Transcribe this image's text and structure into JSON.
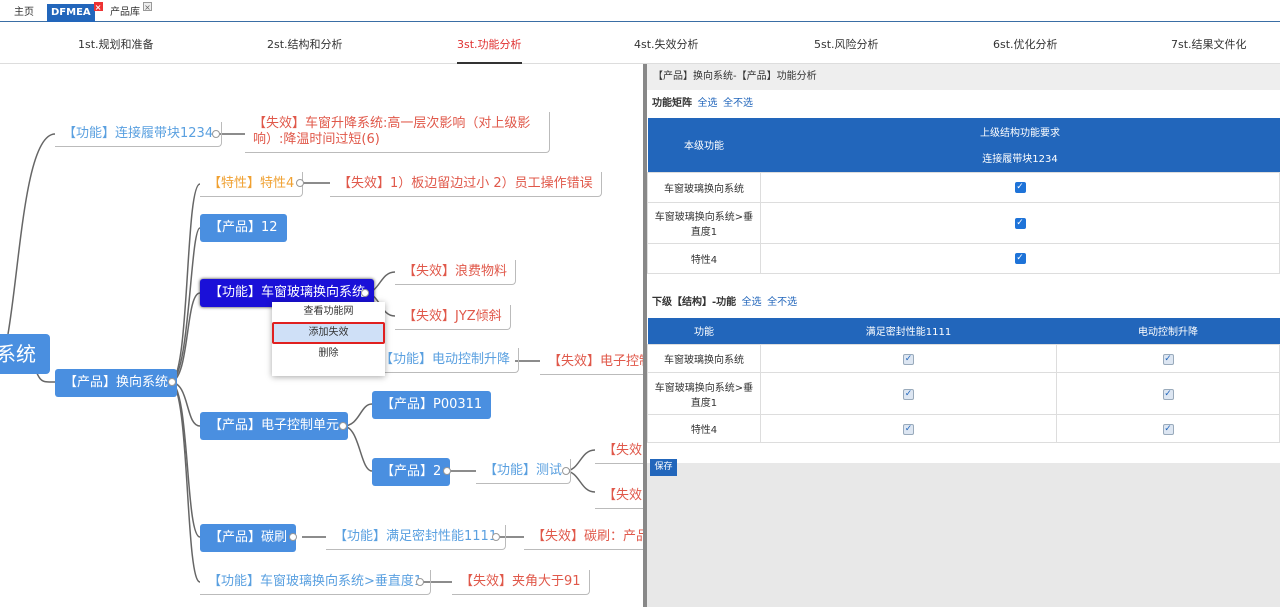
{
  "tabs": [
    {
      "label": "主页"
    },
    {
      "label": "DFMEA"
    },
    {
      "label": "产品库"
    }
  ],
  "steps": [
    "1st.规划和准备",
    "2st.结构和分析",
    "3st.功能分析",
    "4st.失效分析",
    "5st.风险分析",
    "6st.优化分析",
    "7st.结果文件化"
  ],
  "mind": {
    "root": "系统",
    "n1": "【功能】连接履带块1234",
    "n2": "【失效】车窗升降系统:高一层次影响（对上级影响）:降温时间过短(6)",
    "n3": "【特性】特性4",
    "n4": "【失效】1）板边留边过小 2）员工操作错误",
    "n5": "【产品】12",
    "n6": "【功能】车窗玻璃换向系统",
    "n7": "【失效】浪费物料",
    "n8": "【失效】JYZ倾斜",
    "n9": "【功能】电动控制升降",
    "n10": "【失效】电子控制",
    "n11": "【产品】换向系统",
    "n12": "【产品】P00311",
    "n13": "【产品】电子控制单元",
    "n14": "【产品】2",
    "n15": "【功能】测试",
    "n16": "【失效",
    "n17": "【失效",
    "n18": "【产品】碳刷",
    "n19": "【功能】满足密封性能1111",
    "n20": "【失效】碳刷：产品",
    "n21": "【功能】车窗玻璃换向系统>垂直度1",
    "n22": "【失效】夹角大于91"
  },
  "context_menu": {
    "items": [
      "查看功能网",
      "添加失效",
      "删除"
    ]
  },
  "panel": {
    "title": "【产品】换向系统-【产品】功能分析",
    "matrix_label": "功能矩阵",
    "select_all": "全选",
    "select_none": "全不选",
    "upper_header": "上级结构功能要求",
    "level_col": "本级功能",
    "upper_func": "连接履带块1234",
    "rows1": [
      {
        "name": "车窗玻璃换向系统",
        "checked": true
      },
      {
        "name": "车窗玻璃换向系统>垂直度1",
        "checked": true
      },
      {
        "name": "特性4",
        "checked": true
      }
    ],
    "sub_label": "下级【结构】-功能",
    "col_func": "功能",
    "col_a": "满足密封性能1111",
    "col_b": "电动控制升降",
    "rows2": [
      {
        "name": "车窗玻璃换向系统",
        "a": true,
        "b": true
      },
      {
        "name": "车窗玻璃换向系统>垂直度1",
        "a": true,
        "b": true
      },
      {
        "name": "特性4",
        "a": true,
        "b": true
      }
    ],
    "save": "保存"
  }
}
